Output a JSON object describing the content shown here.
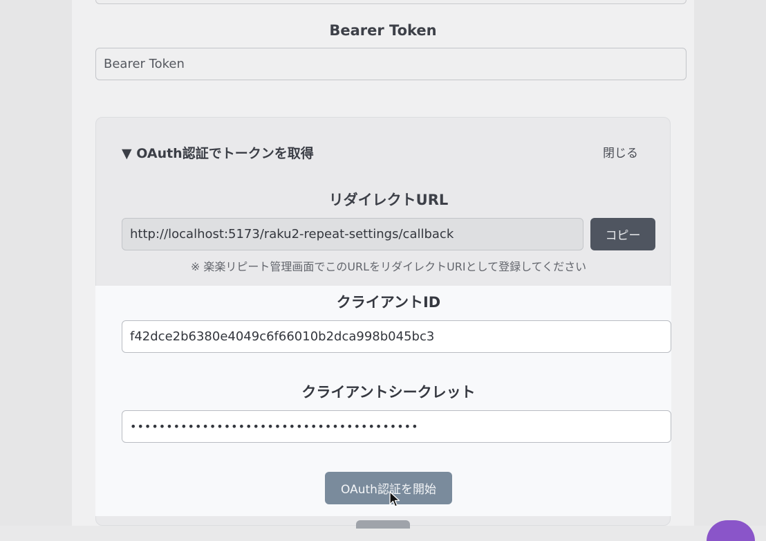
{
  "bearer": {
    "label": "Bearer Token",
    "placeholder": "Bearer Token"
  },
  "oauth": {
    "header": "▼ OAuth認証でトークンを取得",
    "close_label": "閉じる",
    "redirect": {
      "label": "リダイレクトURL",
      "value": "http://localhost:5173/raku2-repeat-settings/callback",
      "copy_label": "コピー",
      "note": "※ 楽楽リピート管理画面でこのURLをリダイレクトURIとして登録してください"
    },
    "client_id": {
      "label": "クライアントID",
      "value": "f42dce2b6380e4049c6f66010b2dca998b045bc3"
    },
    "client_secret": {
      "label": "クライアントシークレット",
      "value": "••••••••••••••••••••••••••••••••••••••••"
    },
    "start_label": "OAuth認証を開始"
  },
  "colors": {
    "primary_button": "#7a8b9c",
    "copy_button": "#4f5560",
    "highlight_panel": "#f8f9fb",
    "dimmed_background": "#e9e9ea",
    "fab": "#8a55c9"
  },
  "icons": {
    "cursor": "arrow-cursor-icon"
  }
}
